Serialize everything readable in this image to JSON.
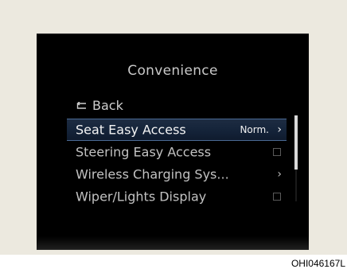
{
  "screen": {
    "title": "Convenience",
    "back": {
      "icon": "back-arrow-icon",
      "label": "Back"
    },
    "items": [
      {
        "label": "Seat Easy Access",
        "value": "Norm.",
        "control": "chevron",
        "selected": true
      },
      {
        "label": "Steering Easy Access",
        "control": "checkbox",
        "checked": false
      },
      {
        "label": "Wireless Charging Sys...",
        "control": "chevron"
      },
      {
        "label": "Wiper/Lights Display",
        "control": "checkbox",
        "checked": false
      }
    ],
    "scrollbar": {
      "visible_fraction": 0.63,
      "position": 0
    }
  },
  "caption": "OHI046167L",
  "colors": {
    "frame_background": "#ece9df",
    "screen_background": "#000000",
    "selection_highlight": "#15243a",
    "selection_border": "#4b6a94",
    "text": "#c2c2c2"
  }
}
